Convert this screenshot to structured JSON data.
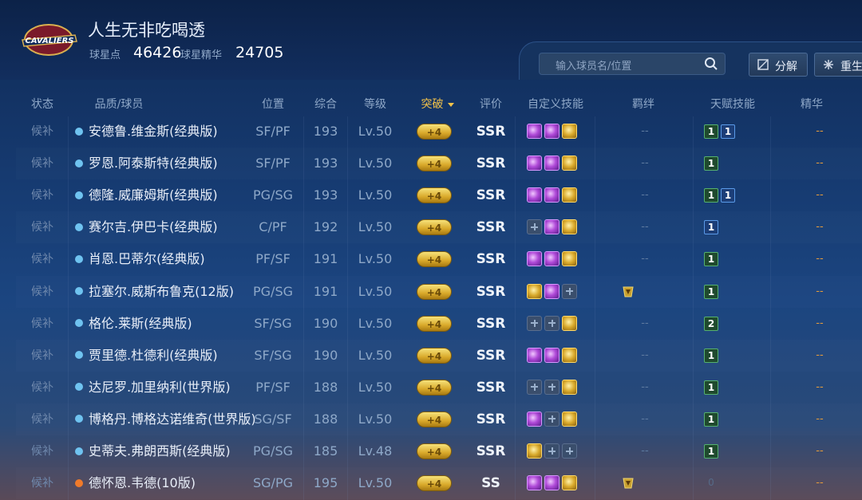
{
  "header": {
    "team_name": "人生无非吃喝透",
    "stats": [
      {
        "label": "球星点",
        "value": "46426"
      },
      {
        "label": "球星精华",
        "value": "24705"
      }
    ]
  },
  "toolbar": {
    "search_placeholder": "输入球员名/位置",
    "decompose_label": "分解",
    "rebirth_label": "重生"
  },
  "columns": {
    "status": "状态",
    "player": "品质/球员",
    "position": "位置",
    "overall": "综合",
    "level": "等级",
    "breakthrough": "突破",
    "rating": "评价",
    "custom_skills": "自定义技能",
    "bond": "羁绊",
    "talent": "天赋技能",
    "essence": "精华"
  },
  "rows": [
    {
      "status": "候补",
      "quality": "blue",
      "name": "安德鲁.维金斯(经典版)",
      "position": "SF/PF",
      "overall": "193",
      "level": "Lv.50",
      "breakthrough": "+4",
      "rating": "SSR",
      "skills": [
        "purple",
        "purple",
        "gold"
      ],
      "bond": "--",
      "talents": [
        {
          "v": "1",
          "c": "green"
        },
        {
          "v": "1",
          "c": "blue"
        }
      ],
      "essence": "--"
    },
    {
      "status": "候补",
      "quality": "blue",
      "name": "罗恩.阿泰斯特(经典版)",
      "position": "SF/PF",
      "overall": "193",
      "level": "Lv.50",
      "breakthrough": "+4",
      "rating": "SSR",
      "skills": [
        "purple",
        "purple",
        "gold"
      ],
      "bond": "--",
      "talents": [
        {
          "v": "1",
          "c": "green"
        }
      ],
      "essence": "--"
    },
    {
      "status": "候补",
      "quality": "blue",
      "name": "德隆.威廉姆斯(经典版)",
      "position": "PG/SG",
      "overall": "193",
      "level": "Lv.50",
      "breakthrough": "+4",
      "rating": "SSR",
      "skills": [
        "purple",
        "purple",
        "gold"
      ],
      "bond": "--",
      "talents": [
        {
          "v": "1",
          "c": "green"
        },
        {
          "v": "1",
          "c": "blue"
        }
      ],
      "essence": "--"
    },
    {
      "status": "候补",
      "quality": "blue",
      "name": "赛尔吉.伊巴卡(经典版)",
      "position": "C/PF",
      "overall": "192",
      "level": "Lv.50",
      "breakthrough": "+4",
      "rating": "SSR",
      "skills": [
        "empty",
        "purple",
        "gold"
      ],
      "bond": "--",
      "talents": [
        {
          "v": "1",
          "c": "blue"
        }
      ],
      "essence": "--"
    },
    {
      "status": "候补",
      "quality": "blue",
      "name": "肖恩.巴蒂尔(经典版)",
      "position": "PF/SF",
      "overall": "191",
      "level": "Lv.50",
      "breakthrough": "+4",
      "rating": "SSR",
      "skills": [
        "purple",
        "purple",
        "gold"
      ],
      "bond": "--",
      "talents": [
        {
          "v": "1",
          "c": "green"
        }
      ],
      "essence": "--"
    },
    {
      "status": "候补",
      "quality": "blue",
      "name": "拉塞尔.威斯布鲁克(12版)",
      "position": "PG/SG",
      "overall": "191",
      "level": "Lv.50",
      "breakthrough": "+4",
      "rating": "SSR",
      "skills": [
        "gold",
        "purple",
        "empty"
      ],
      "bond": "icon",
      "talents": [
        {
          "v": "1",
          "c": "green"
        }
      ],
      "essence": "--"
    },
    {
      "status": "候补",
      "quality": "blue",
      "name": "格伦.莱斯(经典版)",
      "position": "SF/SG",
      "overall": "190",
      "level": "Lv.50",
      "breakthrough": "+4",
      "rating": "SSR",
      "skills": [
        "empty",
        "empty",
        "gold"
      ],
      "bond": "--",
      "talents": [
        {
          "v": "2",
          "c": "green"
        }
      ],
      "essence": "--"
    },
    {
      "status": "候补",
      "quality": "blue",
      "name": "贾里德.杜德利(经典版)",
      "position": "SF/SG",
      "overall": "190",
      "level": "Lv.50",
      "breakthrough": "+4",
      "rating": "SSR",
      "skills": [
        "purple",
        "purple",
        "gold"
      ],
      "bond": "--",
      "talents": [
        {
          "v": "1",
          "c": "green"
        }
      ],
      "essence": "--"
    },
    {
      "status": "候补",
      "quality": "blue",
      "name": "达尼罗.加里纳利(世界版)",
      "position": "PF/SF",
      "overall": "188",
      "level": "Lv.50",
      "breakthrough": "+4",
      "rating": "SSR",
      "skills": [
        "empty",
        "empty",
        "gold"
      ],
      "bond": "--",
      "talents": [
        {
          "v": "1",
          "c": "green"
        }
      ],
      "essence": "--"
    },
    {
      "status": "候补",
      "quality": "blue",
      "name": "博格丹.博格达诺维奇(世界版)",
      "position": "SG/SF",
      "overall": "188",
      "level": "Lv.50",
      "breakthrough": "+4",
      "rating": "SSR",
      "skills": [
        "purple",
        "empty",
        "gold"
      ],
      "bond": "--",
      "talents": [
        {
          "v": "1",
          "c": "green"
        }
      ],
      "essence": "--"
    },
    {
      "status": "候补",
      "quality": "blue",
      "name": "史蒂夫.弗朗西斯(经典版)",
      "position": "PG/SG",
      "overall": "185",
      "level": "Lv.48",
      "breakthrough": "+4",
      "rating": "SSR",
      "skills": [
        "gold",
        "empty",
        "empty"
      ],
      "bond": "--",
      "talents": [
        {
          "v": "1",
          "c": "green"
        }
      ],
      "essence": "--"
    },
    {
      "status": "候补",
      "quality": "orange",
      "name": "德怀恩.韦德(10版)",
      "position": "SG/PG",
      "overall": "195",
      "level": "Lv.50",
      "breakthrough": "+4",
      "rating": "SS",
      "skills": [
        "purple",
        "purple",
        "gold"
      ],
      "bond": "icon",
      "talents": [
        {
          "v": "0",
          "c": "dim"
        }
      ],
      "essence": "--"
    }
  ],
  "colors": {
    "blue_dot": "#6fc3f0",
    "orange_dot": "#f07a2a"
  }
}
